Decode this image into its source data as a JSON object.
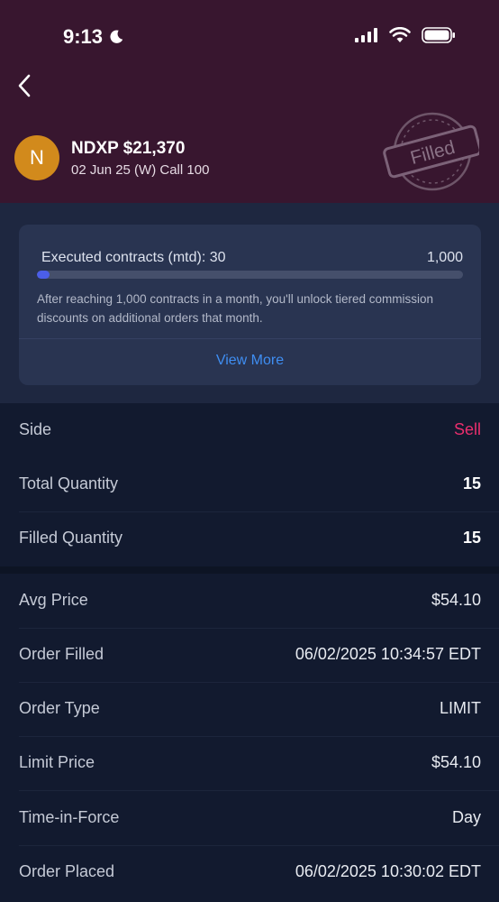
{
  "status_bar": {
    "time": "9:13"
  },
  "header": {
    "avatar_letter": "N",
    "title": "NDXP $21,370",
    "subtitle": "02 Jun 25 (W) Call 100",
    "stamp_label": "Filled"
  },
  "commission_card": {
    "label": "Executed contracts (mtd): 30",
    "max": "1,000",
    "progress": 0.03,
    "description": "After reaching 1,000 contracts in a month, you'll unlock tiered commission discounts on additional orders that month.",
    "view_more": "View More",
    "accent_color": "#4b5ee8"
  },
  "order_summary": [
    {
      "label": "Side",
      "value": "Sell"
    },
    {
      "label": "Total Quantity",
      "value": "15"
    },
    {
      "label": "Filled Quantity",
      "value": "15"
    }
  ],
  "order_details": [
    {
      "label": "Avg Price",
      "value": "$54.10"
    },
    {
      "label": "Order Filled",
      "value": "06/02/2025 10:34:57 EDT"
    },
    {
      "label": "Order Type",
      "value": "LIMIT"
    },
    {
      "label": "Limit Price",
      "value": "$54.10"
    },
    {
      "label": "Time-in-Force",
      "value": "Day"
    },
    {
      "label": "Order Placed",
      "value": "06/02/2025 10:30:02 EDT"
    }
  ],
  "colors": {
    "header_bg": "#38162f",
    "sell": "#ea2e6e",
    "link": "#3f8ef2"
  }
}
